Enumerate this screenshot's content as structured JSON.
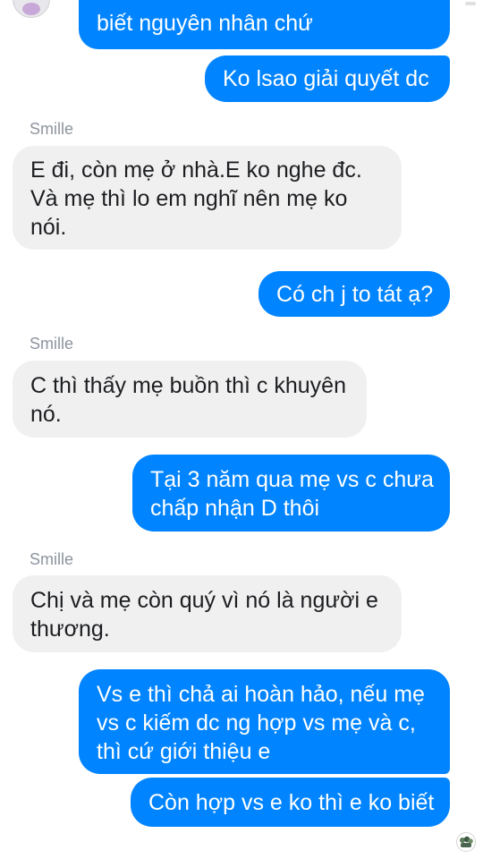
{
  "conversation": {
    "sender_name": "Smille",
    "messages": [
      {
        "side": "out",
        "lines": [
          "biết nguyên nhân chứ"
        ]
      },
      {
        "side": "out",
        "lines": [
          "Ko lsao giải quyết dc"
        ]
      },
      {
        "side": "in",
        "lines": [
          "E đi, còn mẹ ở nhà.E ko nghe đc.",
          "Và mẹ thì lo em nghĩ nên mẹ ko",
          "nói."
        ]
      },
      {
        "side": "out",
        "lines": [
          "Có ch j to tát ạ?"
        ]
      },
      {
        "side": "in",
        "lines": [
          "C thì thấy mẹ buồn thì c khuyên",
          "nó."
        ]
      },
      {
        "side": "out",
        "lines": [
          "Tại 3 năm qua mẹ vs c chưa",
          "chấp nhận D thôi"
        ]
      },
      {
        "side": "in",
        "lines": [
          "Chị và mẹ còn quý vì nó là người e",
          "thương."
        ]
      },
      {
        "side": "out",
        "lines": [
          "Vs e thì chả ai hoàn hảo, nếu mẹ",
          "vs c kiếm dc ng hợp vs mẹ và c,",
          "thì cứ giới thiệu e"
        ]
      },
      {
        "side": "out",
        "lines": [
          "Còn hợp vs e ko thì e ko biết"
        ]
      }
    ]
  },
  "colors": {
    "outgoing_bubble": "#0084ff",
    "incoming_bubble": "#f1f0f0",
    "outgoing_text": "#ffffff",
    "incoming_text": "#1c1e21",
    "sender_label": "#8d949e"
  },
  "icons": {
    "contact_avatar": "avatar-icon",
    "seen_indicator": "seen-avatar-icon"
  }
}
